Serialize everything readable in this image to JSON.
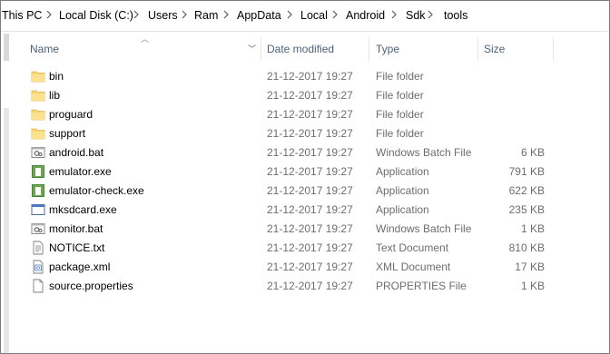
{
  "breadcrumb": [
    "This PC",
    "Local Disk (C:)",
    "Users",
    "Ram",
    "AppData",
    "Local",
    "Android",
    "Sdk",
    "tools"
  ],
  "columns": {
    "name": "Name",
    "date": "Date modified",
    "type": "Type",
    "size": "Size"
  },
  "files": [
    {
      "name": "bin",
      "date": "21-12-2017 19:27",
      "type": "File folder",
      "size": "",
      "icon": "folder-icon"
    },
    {
      "name": "lib",
      "date": "21-12-2017 19:27",
      "type": "File folder",
      "size": "",
      "icon": "folder-icon"
    },
    {
      "name": "proguard",
      "date": "21-12-2017 19:27",
      "type": "File folder",
      "size": "",
      "icon": "folder-icon"
    },
    {
      "name": "support",
      "date": "21-12-2017 19:27",
      "type": "File folder",
      "size": "",
      "icon": "folder-icon"
    },
    {
      "name": "android.bat",
      "date": "21-12-2017 19:27",
      "type": "Windows Batch File",
      "size": "6 KB",
      "icon": "batch-file-icon"
    },
    {
      "name": "emulator.exe",
      "date": "21-12-2017 19:27",
      "type": "Application",
      "size": "791 KB",
      "icon": "application-icon"
    },
    {
      "name": "emulator-check.exe",
      "date": "21-12-2017 19:27",
      "type": "Application",
      "size": "622 KB",
      "icon": "application-icon"
    },
    {
      "name": "mksdcard.exe",
      "date": "21-12-2017 19:27",
      "type": "Application",
      "size": "235 KB",
      "icon": "window-app-icon"
    },
    {
      "name": "monitor.bat",
      "date": "21-12-2017 19:27",
      "type": "Windows Batch File",
      "size": "1 KB",
      "icon": "batch-file-icon"
    },
    {
      "name": "NOTICE.txt",
      "date": "21-12-2017 19:27",
      "type": "Text Document",
      "size": "810 KB",
      "icon": "text-file-icon"
    },
    {
      "name": "package.xml",
      "date": "21-12-2017 19:27",
      "type": "XML Document",
      "size": "17 KB",
      "icon": "xml-file-icon"
    },
    {
      "name": "source.properties",
      "date": "21-12-2017 19:27",
      "type": "PROPERTIES File",
      "size": "1 KB",
      "icon": "blank-file-icon"
    }
  ],
  "colors": {
    "header_text": "#4c607a",
    "detail_text": "#6d6d6d",
    "folder": "#f8d775"
  }
}
